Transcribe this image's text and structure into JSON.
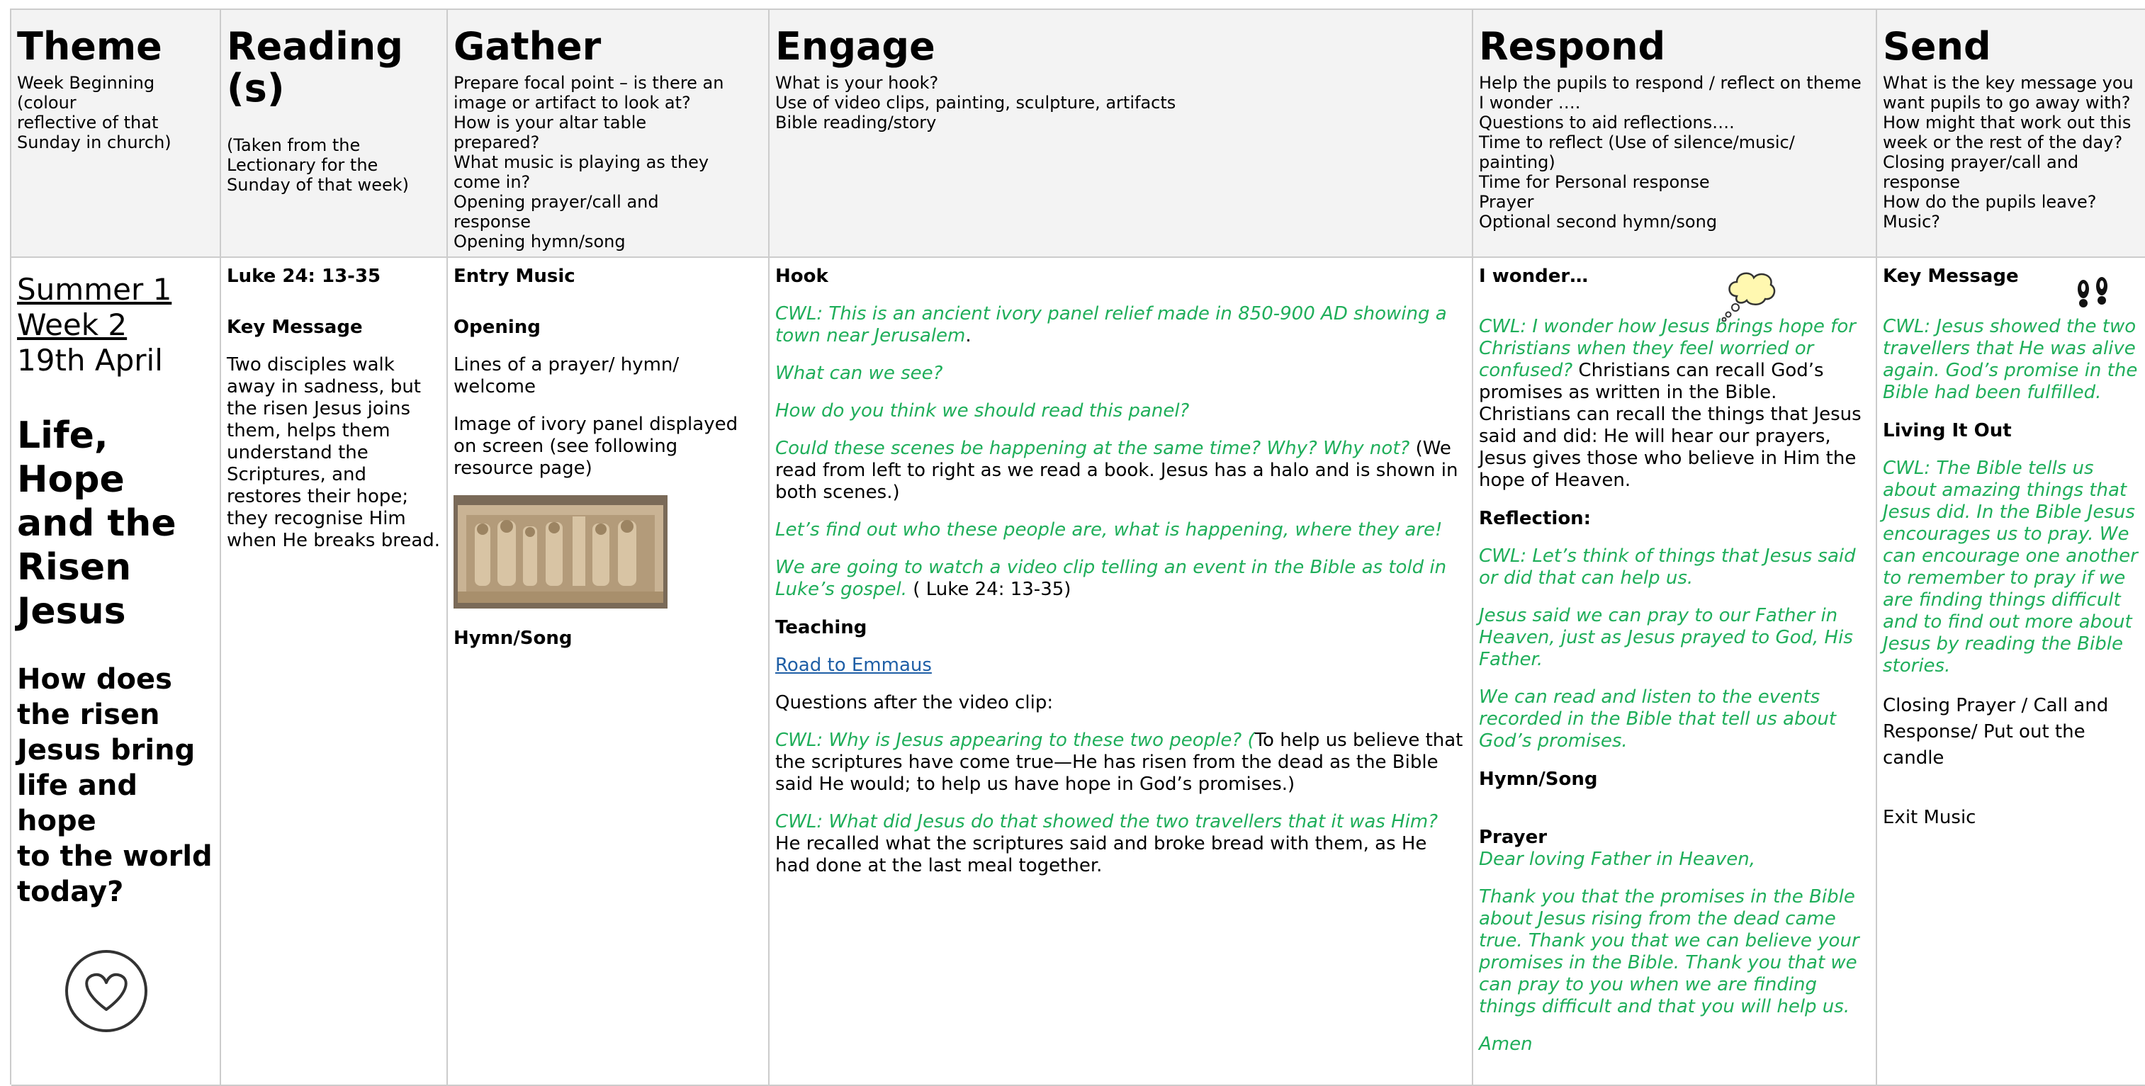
{
  "headers": [
    {
      "title": "Theme",
      "desc": "Week Beginning (colour\nreflective of that\nSunday in church)"
    },
    {
      "title": "Reading (s)",
      "desc": "\n(Taken from the\nLectionary for the\nSunday of that week)"
    },
    {
      "title": "Gather",
      "desc": "Prepare focal point – is there an\n image or artifact to look at?\nHow is your altar table\n prepared?\nWhat music is playing as they\n come in?\nOpening prayer/call and\n response\nOpening hymn/song"
    },
    {
      "title": "Engage",
      "desc": "What is your hook?\nUse of video clips, painting, sculpture, artifacts\nBible reading/story"
    },
    {
      "title": "Respond",
      "desc": "Help the pupils to respond / reflect on theme\nI wonder ….\nQuestions to aid reflections….\nTime to reflect (Use of silence/music/\npainting)\nTime for Personal response\nPrayer\nOptional second hymn/song"
    },
    {
      "title": "Send",
      "desc": "What is the key message you\nwant pupils to go away with?\nHow might that work out this\nweek or the rest of the day?\nClosing prayer/call and\nresponse\nHow do the pupils leave?\nMusic?"
    }
  ],
  "theme": {
    "week": "Summer 1\nWeek 2",
    "date": "19th April",
    "title": "Life, Hope\nand the\nRisen\nJesus",
    "question": "How does\nthe risen\nJesus bring\nlife and hope\nto the world\ntoday?",
    "icon": "heart-icon"
  },
  "reading": {
    "ref": "Luke 24: 13-35",
    "key_label": "Key Message",
    "key_text": "Two disciples walk away in sadness, but the risen Jesus joins them, helps them understand the Scriptures, and restores their hope; they recognise Him when He breaks bread."
  },
  "gather": {
    "entry": "Entry Music",
    "opening": "Opening",
    "lines": "Lines of a prayer/ hymn/ welcome",
    "image_text": "Image of ivory panel displayed on screen (see following resource page)",
    "hymn": "Hymn/Song"
  },
  "engage": {
    "hook": "Hook",
    "g1": "CWL: This is an ancient ivory panel relief made in 850-900 AD showing a town near Jerusalem",
    "g1_tail": ".",
    "g2": "What can we see?",
    "g3": "How do you think we should read this panel?",
    "g4": "Could these scenes be happening at the same time? Why? Why not?",
    "g4_tail": " (We read from left to right as we read a book. Jesus has a halo and is shown in both scenes.)",
    "g5": "Let’s find out who these people are, what is happening, where they are!",
    "g6": "We are going to watch a video clip telling an event in the Bible as told in Luke’s gospel.",
    "g6_tail": " ( Luke 24: 13-35)",
    "teaching": "Teaching",
    "link": "Road to Emmaus",
    "questions": "Questions after the video clip:",
    "q1": "CWL: Why is Jesus appearing to these two people? (",
    "q1_tail": "To help us believe that the scriptures have come true—He has risen from the dead as the Bible said He would; to help us have hope in God’s promises.)",
    "q2": "CWL: What did Jesus do that showed the two travellers that it was Him?",
    "q2_tail": " He recalled what the scriptures said and broke bread with them, as He had done at the last meal together."
  },
  "respond": {
    "wonder": "I wonder…",
    "w1": "CWL: I wonder how Jesus brings hope for Christians when they feel worried or confused?",
    "w1_tail": " Christians can recall God’s promises as written in the Bible. Christians can recall the things that Jesus said and did: He will hear our prayers, Jesus gives those who believe in Him the hope of Heaven.",
    "reflection": "Reflection:",
    "r1": "CWL: Let’s think of things that Jesus said or did that can help us.",
    "r2": "Jesus said we can pray to our Father in Heaven, just as Jesus prayed to God, His Father.",
    "r3": "We can read and listen to the events recorded in the Bible that tell us about God’s promises.",
    "hymn": "Hymn/Song",
    "prayer": "Prayer",
    "p1": "Dear loving Father in Heaven,",
    "p2": "Thank you that the promises in the Bible about Jesus rising from the dead came true. Thank you that we can believe your promises in the Bible. Thank you that we can pray to you when we are finding things difficult and that you will help us.",
    "amen": "Amen",
    "icon": "thought-bubble-icon"
  },
  "send": {
    "key_label": "Key Message",
    "k1": "CWL: Jesus showed the two travellers that  He was alive again. God’s promise in the Bible had been fulfilled.",
    "living": "Living It Out",
    "l1": "CWL: The Bible tells us about amazing things that Jesus did. In the Bible Jesus encourages us to pray. We can encourage one another to remember to pray if we are finding things difficult and to find out more about Jesus by reading the Bible stories.",
    "closing": "Closing Prayer / Call and Response/ Put out the candle",
    "exit": "Exit Music",
    "icon": "footprints-icon"
  }
}
